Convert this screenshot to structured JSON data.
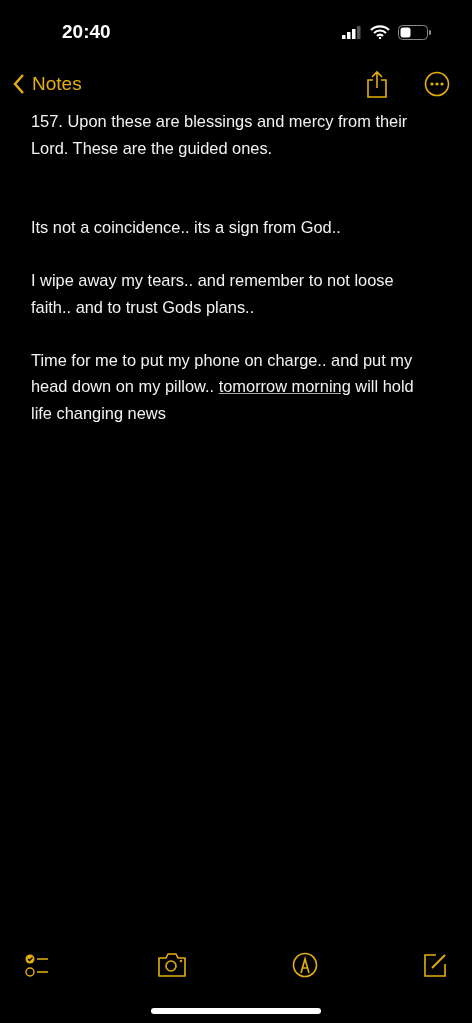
{
  "status_bar": {
    "time": "20:40"
  },
  "nav": {
    "back_label": "Notes"
  },
  "note": {
    "verse": "157. Upon these are blessings and mercy from their Lord. These are the guided ones.",
    "paragraphs": [
      {
        "segments": [
          {
            "kind": "text",
            "text": "Its not a coincidence.. its a sign from God.."
          }
        ]
      },
      {
        "segments": [
          {
            "kind": "text",
            "text": "I wipe away my tears.. and remember to not loose faith.. and to trust Gods plans.."
          }
        ]
      },
      {
        "segments": [
          {
            "kind": "text",
            "text": "Time for me to put my phone on charge.. and put my head down on my pillow.. "
          },
          {
            "kind": "link",
            "text": "tomorrow morning"
          },
          {
            "kind": "text",
            "text": " will hold life changing news"
          }
        ]
      }
    ]
  }
}
